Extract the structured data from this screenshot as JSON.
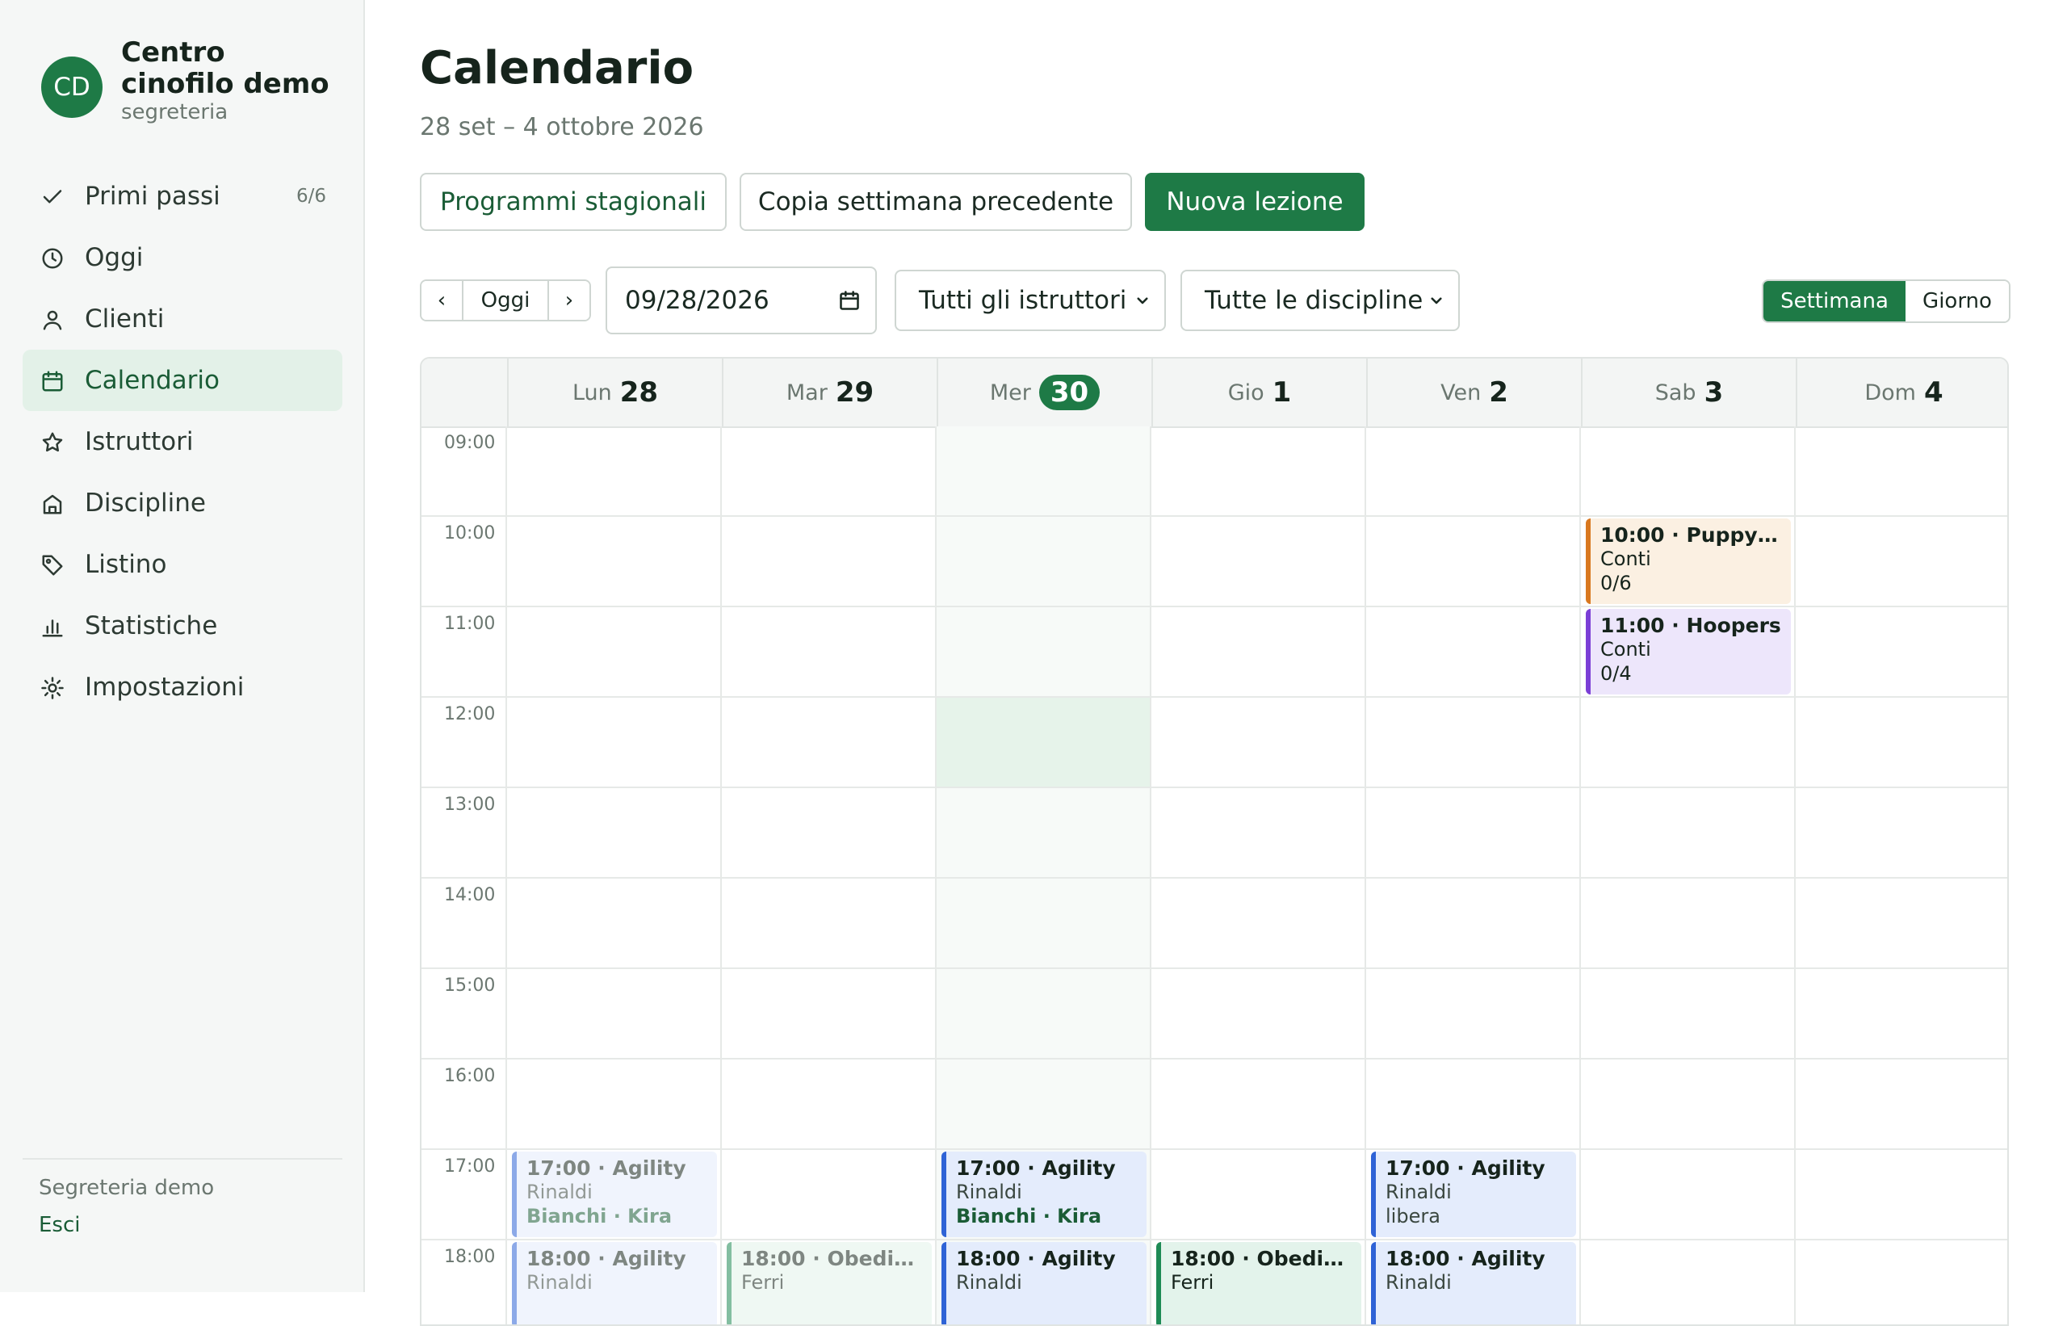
{
  "brand": {
    "initials": "CD",
    "name": "Centro cinofilo demo",
    "role": "segreteria"
  },
  "nav": [
    {
      "label": "Primi passi",
      "icon": "check-icon",
      "count": "6/6"
    },
    {
      "label": "Oggi",
      "icon": "clock-icon"
    },
    {
      "label": "Clienti",
      "icon": "user-icon"
    },
    {
      "label": "Calendario",
      "icon": "calendar-icon",
      "active": true
    },
    {
      "label": "Istruttori",
      "icon": "star-icon"
    },
    {
      "label": "Discipline",
      "icon": "building-icon"
    },
    {
      "label": "Listino",
      "icon": "tag-icon"
    },
    {
      "label": "Statistiche",
      "icon": "bar-chart-icon"
    },
    {
      "label": "Impostazioni",
      "icon": "sun-gear-icon"
    }
  ],
  "footer": {
    "user": "Segreteria demo",
    "logout": "Esci"
  },
  "header": {
    "title": "Calendario",
    "subtitle": "28 set – 4 ottobre 2026",
    "btn_programs": "Programmi stagionali",
    "btn_copy": "Copia settimana precedente",
    "btn_new": "Nuova lezione"
  },
  "toolbar": {
    "prev": "‹",
    "today": "Oggi",
    "next": "›",
    "date": "09/28/2026",
    "instructor_select": "Tutti gli istruttori",
    "discipline_select": "Tutte le discipline",
    "view_week": "Settimana",
    "view_day": "Giorno"
  },
  "days": [
    {
      "name": "Lun",
      "num": "28"
    },
    {
      "name": "Mar",
      "num": "29"
    },
    {
      "name": "Mer",
      "num": "30",
      "today": true
    },
    {
      "name": "Gio",
      "num": "1"
    },
    {
      "name": "Ven",
      "num": "2"
    },
    {
      "name": "Sab",
      "num": "3"
    },
    {
      "name": "Dom",
      "num": "4"
    }
  ],
  "hours": [
    "09:00",
    "10:00",
    "11:00",
    "12:00",
    "13:00",
    "14:00",
    "15:00",
    "16:00",
    "17:00",
    "18:00"
  ],
  "events": [
    {
      "day": 5,
      "hour": 1,
      "type": "puppy",
      "title": "10:00 · Puppy ...",
      "instructor": "Conti",
      "extra": "0/6"
    },
    {
      "day": 5,
      "hour": 2,
      "type": "hoop",
      "title": "11:00 · Hoopers",
      "instructor": "Conti",
      "extra": "0/4"
    },
    {
      "day": 0,
      "hour": 8,
      "type": "agility",
      "past": true,
      "title": "17:00 · Agility",
      "instructor": "Rinaldi",
      "participant": "Bianchi · Kira"
    },
    {
      "day": 2,
      "hour": 8,
      "type": "agility",
      "title": "17:00 · Agility",
      "instructor": "Rinaldi",
      "participant": "Bianchi · Kira"
    },
    {
      "day": 4,
      "hour": 8,
      "type": "agility",
      "title": "17:00 · Agility",
      "instructor": "Rinaldi",
      "extra": "libera"
    },
    {
      "day": 0,
      "hour": 9,
      "type": "agility",
      "past": true,
      "title": "18:00 · Agility",
      "instructor": "Rinaldi"
    },
    {
      "day": 1,
      "hour": 9,
      "type": "obed",
      "past": true,
      "title": "18:00 · Obedie...",
      "instructor": "Ferri"
    },
    {
      "day": 2,
      "hour": 9,
      "type": "agility",
      "title": "18:00 · Agility",
      "instructor": "Rinaldi"
    },
    {
      "day": 3,
      "hour": 9,
      "type": "obed",
      "title": "18:00 · Obedie...",
      "instructor": "Ferri"
    },
    {
      "day": 4,
      "hour": 9,
      "type": "agility",
      "title": "18:00 · Agility",
      "instructor": "Rinaldi"
    }
  ]
}
